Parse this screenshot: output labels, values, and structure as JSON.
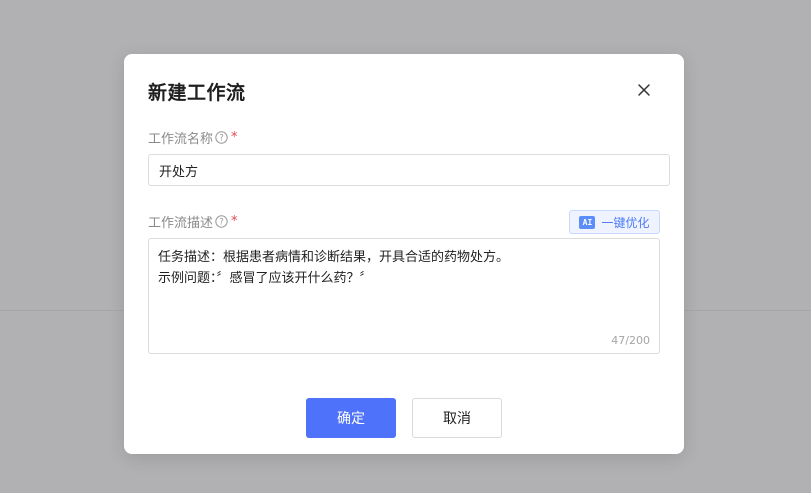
{
  "modal": {
    "title": "新建工作流",
    "close_icon": "close-icon"
  },
  "name_field": {
    "label": "工作流名称",
    "required_mark": "*",
    "value": "开处方"
  },
  "description_field": {
    "label": "工作流描述",
    "required_mark": "*",
    "optimize_badge": "AI",
    "optimize_label": "一键优化",
    "value": "任务描述：根据患者病情和诊断结果，开具合适的药物处方。\n示例问题：〞感冒了应该开什么药？〞",
    "char_count": "47/200"
  },
  "actions": {
    "confirm_label": "确定",
    "cancel_label": "取消"
  },
  "colors": {
    "primary": "#4e72fa",
    "required": "#e5484d",
    "overlay": "#b1b1b3"
  }
}
